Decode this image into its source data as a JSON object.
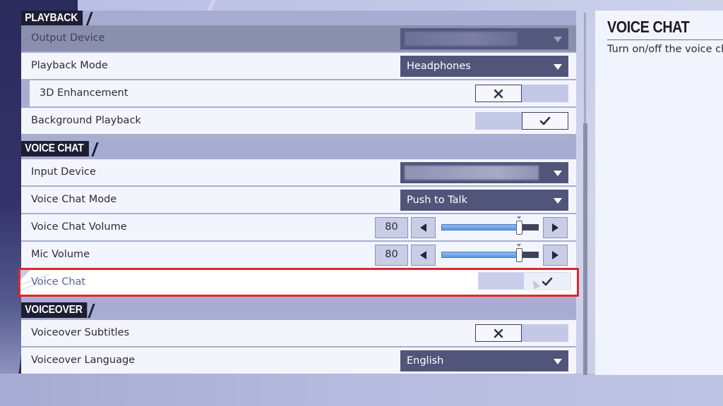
{
  "sections": {
    "playback": {
      "title": "PLAYBACK",
      "output_device": {
        "label": "Output Device",
        "value": "",
        "state": "disabled"
      },
      "playback_mode": {
        "label": "Playback Mode",
        "value": "Headphones"
      },
      "enhancement_3d": {
        "label": "3D Enhancement",
        "value": "off"
      },
      "background_playback": {
        "label": "Background Playback",
        "value": "on"
      }
    },
    "voice_chat": {
      "title": "VOICE CHAT",
      "input_device": {
        "label": "Input Device",
        "value": ""
      },
      "voice_chat_mode": {
        "label": "Voice Chat Mode",
        "value": "Push to Talk"
      },
      "voice_chat_volume": {
        "label": "Voice Chat Volume",
        "value": "80",
        "percent": 80
      },
      "mic_volume": {
        "label": "Mic Volume",
        "value": "80",
        "percent": 80
      },
      "voice_chat_toggle": {
        "label": "Voice Chat",
        "value": "on",
        "selected": true
      }
    },
    "voiceover": {
      "title": "VOICEOVER",
      "subtitles": {
        "label": "Voiceover Subtitles",
        "value": "off"
      },
      "language": {
        "label": "Voiceover Language",
        "value": "English"
      }
    }
  },
  "info_panel": {
    "title": "VOICE CHAT",
    "description": "Turn on/off the voice chat"
  },
  "icons": {
    "toggle_on": "checkmark-icon",
    "toggle_off": "x-icon",
    "dropdown": "caret-down-icon",
    "decrement": "triangle-left-icon",
    "increment": "triangle-right-icon"
  },
  "colors": {
    "selection_border": "#e0262a",
    "section_label_bg": "#1d1d33",
    "dropdown_bg": "#51557a",
    "slider_fill": "#6a9fe8",
    "row_bg": "#f3f5fc"
  }
}
